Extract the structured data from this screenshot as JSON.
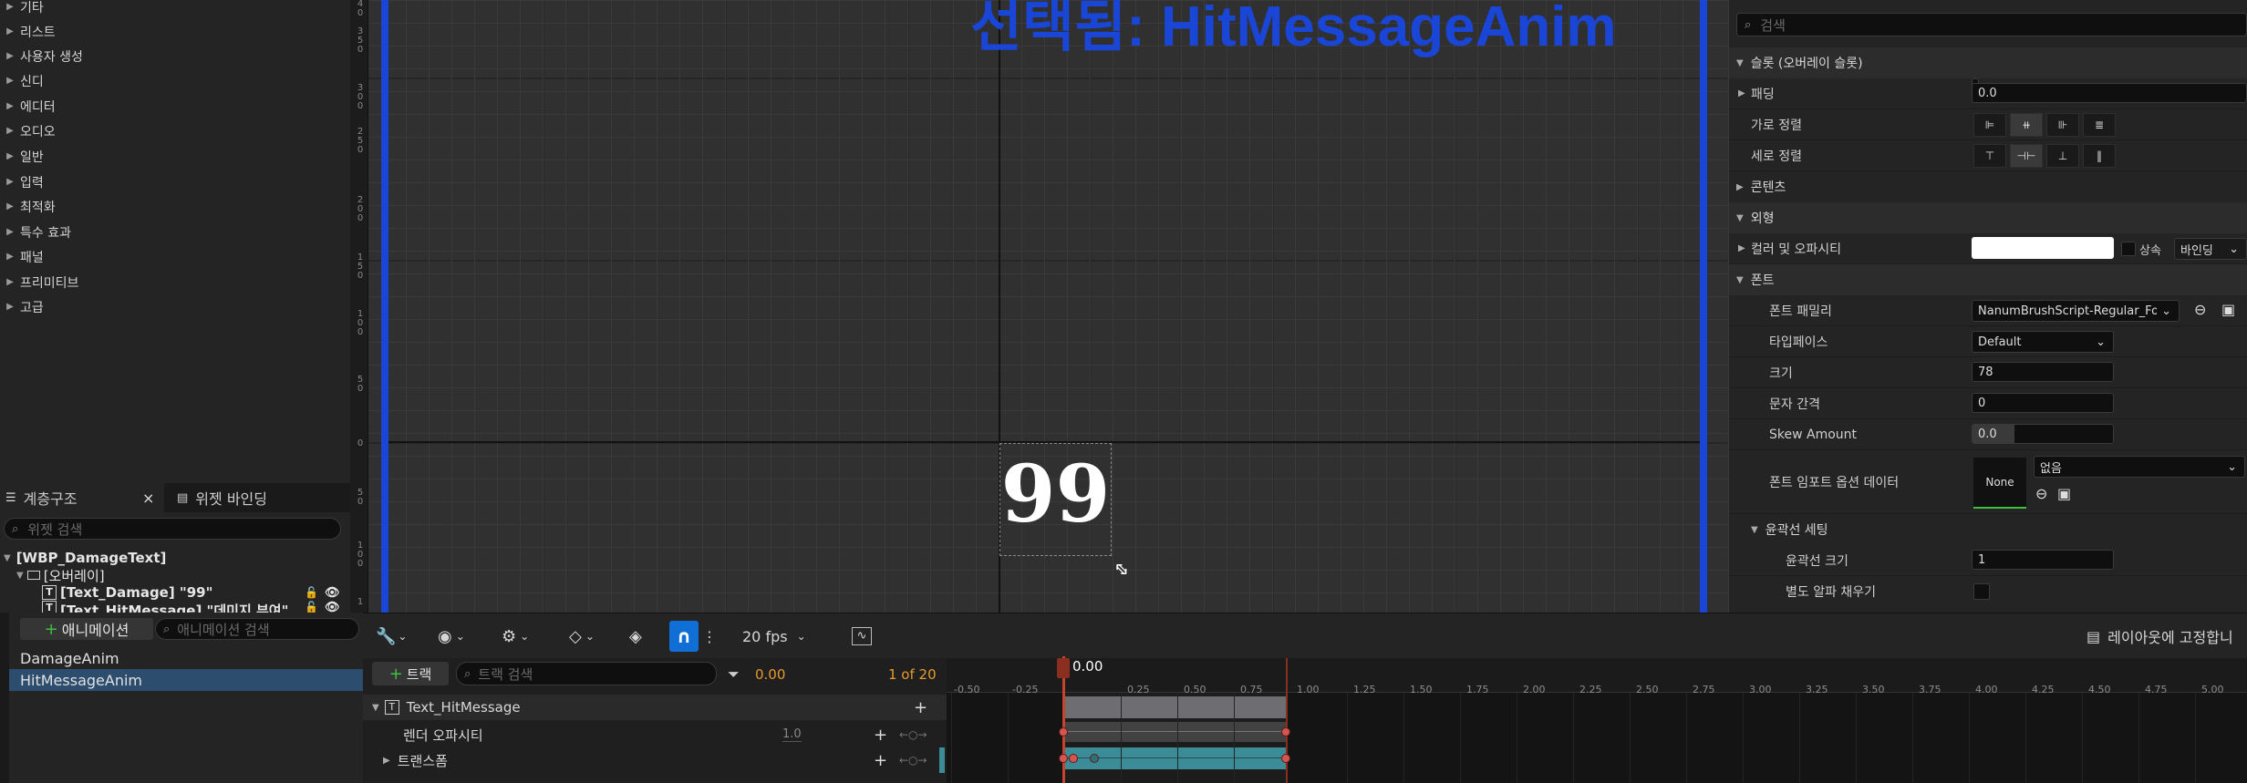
{
  "palette": {
    "items": [
      "기타",
      "리스트",
      "사용자 생성",
      "신디",
      "에디터",
      "오디오",
      "일반",
      "입력",
      "최적화",
      "특수 효과",
      "패널",
      "프리미티브",
      "고급"
    ]
  },
  "hierarchy": {
    "tab_hierarchy": "계층구조",
    "tab_bindings": "위젯 바인딩",
    "close": "×",
    "search_placeholder": "위젯 검색",
    "tree": [
      "[WBP_DamageText]",
      "[오버레이]",
      "[Text_Damage] \"99\"",
      "[Text_HitMessage] \"데미지 부여\""
    ]
  },
  "animations": {
    "add_label": "애니메이션",
    "search_placeholder": "애니메이션 검색",
    "items": [
      "DamageAnim",
      "HitMessageAnim"
    ]
  },
  "viewport": {
    "selected_text": "선택됨: HitMessageAnim",
    "widget_text": "99",
    "ruler_labels": [
      "4\n0",
      "3\n5\n0",
      "3\n0\n0",
      "2\n5\n0",
      "2\n0\n0",
      "1\n5\n0",
      "1\n0\n0",
      "5\n0",
      "0",
      "5\n0",
      "1\n0\n0",
      "1"
    ]
  },
  "details": {
    "search_placeholder": "검색",
    "sections": {
      "slot": "슬롯 (오버레이 슬롯)",
      "content": "콘텐츠",
      "appearance": "외형",
      "font": "폰트",
      "outline": "윤곽선 세팅"
    },
    "rows": {
      "padding": {
        "label": "패딩",
        "value": "0.0"
      },
      "h_align": {
        "label": "가로 정렬"
      },
      "v_align": {
        "label": "세로 정렬"
      },
      "color": {
        "label": "컬러 및 오파시티",
        "inherit": "상속",
        "bind": "바인딩"
      },
      "font_family": {
        "label": "폰트 패밀리",
        "value": "NanumBrushScript-Regular_Font"
      },
      "typeface": {
        "label": "타입페이스",
        "value": "Default"
      },
      "size": {
        "label": "크기",
        "value": "78"
      },
      "letter_spacing": {
        "label": "문자 간격",
        "value": "0"
      },
      "skew": {
        "label": "Skew Amount",
        "value": "0.0"
      },
      "font_import": {
        "label": "폰트 임포트 옵션 데이터",
        "thumb": "None",
        "value": "없음"
      },
      "outline_size": {
        "label": "윤곽선 크기",
        "value": "1"
      },
      "separate_alpha": {
        "label": "별도 알파 채우기"
      }
    }
  },
  "sequencer": {
    "fps": "20 fps",
    "add_track": "트랙",
    "track_search_placeholder": "트랙 검색",
    "current_time": "0.00",
    "frame_count": "1 of 20",
    "playhead_label": "0.00",
    "lock_layout": "레이아웃에 고정합니",
    "tracks": [
      {
        "name": "Text_HitMessage"
      },
      {
        "name": "렌더 오파시티",
        "value": "1.0"
      },
      {
        "name": "트랜스폼"
      }
    ],
    "ticks": [
      "-0.50",
      "-0.25",
      "0.25",
      "0.50",
      "0.75",
      "1.00",
      "1.25",
      "1.50",
      "1.75",
      "2.00",
      "2.25",
      "2.50",
      "2.75",
      "3.00",
      "3.25",
      "3.50",
      "3.75",
      "4.00",
      "4.25",
      "4.50",
      "4.75",
      "5.00"
    ]
  },
  "colors": {
    "accent_blue": "#1a46d8",
    "selected_row": "#2c4d6e",
    "keyframe": "#d5554f",
    "track_teal": "#3b8c96"
  }
}
